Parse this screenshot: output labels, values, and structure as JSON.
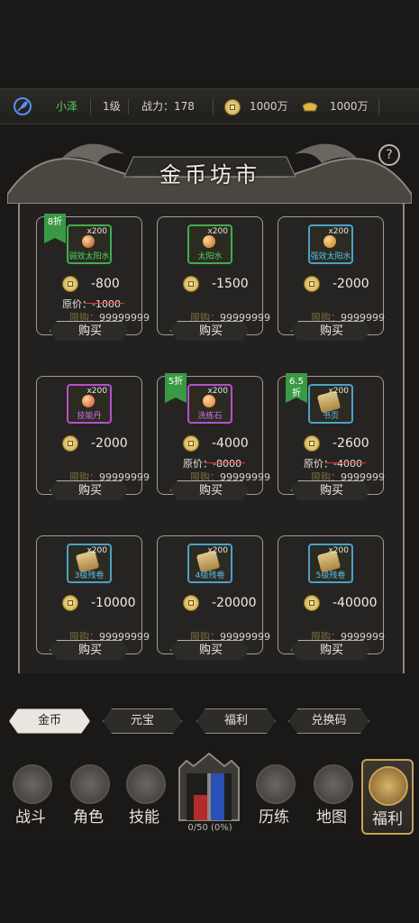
{
  "topbar": {
    "player_name": "小泽",
    "level": "1级",
    "power_label": "战力：178",
    "gold": "1000万",
    "ingot": "1000万"
  },
  "shop": {
    "title": "金币坊市",
    "help": "?",
    "items": [
      {
        "qty": "x200",
        "name": "弱效太阳水",
        "color": "green",
        "badge": "8折",
        "price": "-800",
        "original": "原价：-1000",
        "limit_label": "限购：",
        "limit": "99999999",
        "buy": "购买",
        "orb": "#b5451f"
      },
      {
        "qty": "x200",
        "name": "太阳水",
        "color": "green",
        "badge": "",
        "price": "-1500",
        "original": "",
        "limit_label": "限购：",
        "limit": "99999999",
        "buy": "购买",
        "orb": "#c06a1a"
      },
      {
        "qty": "x200",
        "name": "强效太阳水",
        "color": "blue",
        "badge": "",
        "price": "-2000",
        "original": "",
        "limit_label": "限购：",
        "limit": "9999999",
        "buy": "购买",
        "orb": "#c87a14"
      },
      {
        "qty": "x200",
        "name": "技能丹",
        "color": "purple",
        "badge": "",
        "price": "-2000",
        "original": "",
        "limit_label": "限购：",
        "limit": "99999999",
        "buy": "购买",
        "orb": "#d04a22"
      },
      {
        "qty": "x200",
        "name": "洗练石",
        "color": "purple",
        "badge": "5折",
        "price": "-4000",
        "original": "原价：-8000",
        "limit_label": "限购：",
        "limit": "99999999",
        "buy": "购买",
        "orb": "#e0772e"
      },
      {
        "qty": "x200",
        "name": "书页",
        "color": "blue",
        "badge": "6.5折",
        "price": "-2600",
        "original": "原价：-4000",
        "limit_label": "限购：",
        "limit": "9999999",
        "buy": "购买",
        "orb": ""
      },
      {
        "qty": "x200",
        "name": "3级残卷",
        "color": "blue",
        "badge": "",
        "price": "-10000",
        "original": "",
        "limit_label": "限购：",
        "limit": "99999999",
        "buy": "购买",
        "orb": ""
      },
      {
        "qty": "x200",
        "name": "4级残卷",
        "color": "blue",
        "badge": "",
        "price": "-20000",
        "original": "",
        "limit_label": "限购：",
        "limit": "99999999",
        "buy": "购买",
        "orb": ""
      },
      {
        "qty": "x200",
        "name": "5级残卷",
        "color": "blue",
        "badge": "",
        "price": "-40000",
        "original": "",
        "limit_label": "限购：",
        "limit": "9999999",
        "buy": "购买",
        "orb": ""
      }
    ]
  },
  "tabs": [
    "金币",
    "元宝",
    "福利",
    "兑换码"
  ],
  "nav": [
    "战斗",
    "角色",
    "技能",
    "历练",
    "地图",
    "福利"
  ],
  "progress": "0/50 (0%)"
}
